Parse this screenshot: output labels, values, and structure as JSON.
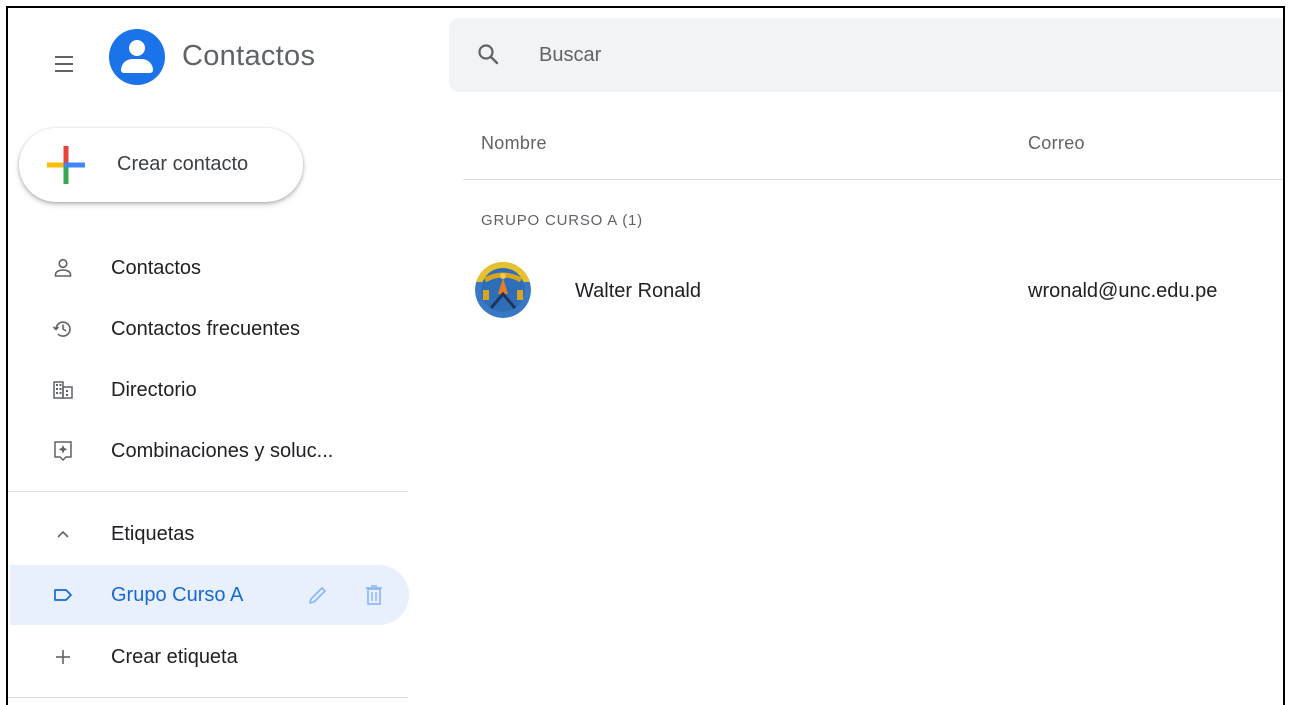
{
  "app": {
    "title": "Contactos",
    "brand_color": "#1a73e8"
  },
  "search": {
    "placeholder": "Buscar",
    "value": ""
  },
  "create_button": {
    "label": "Crear contacto"
  },
  "sidebar": {
    "items": [
      {
        "label": "Contactos",
        "icon": "person-icon"
      },
      {
        "label": "Contactos frecuentes",
        "icon": "history-icon"
      },
      {
        "label": "Directorio",
        "icon": "domain-icon"
      },
      {
        "label": "Combinaciones y soluc...",
        "icon": "merge-icon"
      }
    ],
    "labels_section": {
      "title": "Etiquetas",
      "icon": "chevron-up-icon",
      "labels": [
        {
          "label": "Grupo Curso A",
          "icon": "label-icon",
          "active": true,
          "active_color": "#1967d2",
          "active_bg": "#e8f0fe"
        }
      ],
      "create_label": "Crear etiqueta"
    }
  },
  "list": {
    "columns": [
      "Nombre",
      "Correo"
    ],
    "group_title": "GRUPO CURSO A (1)",
    "rows": [
      {
        "name": "Walter Ronald",
        "email": "wronald@unc.edu.pe",
        "avatar": "university-seal"
      }
    ]
  }
}
